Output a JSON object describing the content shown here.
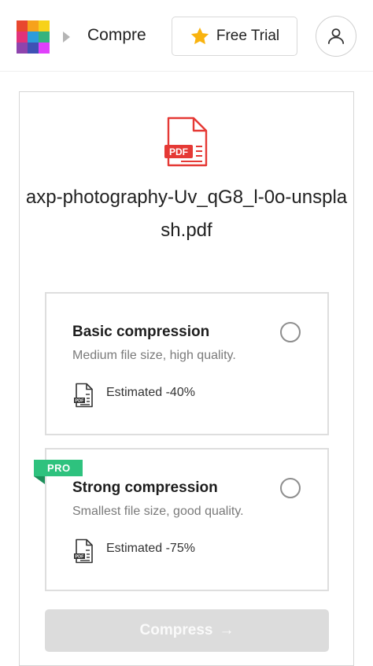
{
  "header": {
    "breadcrumb_label": "Compre",
    "free_trial_label": "Free Trial",
    "logo_colors": [
      "#e8472f",
      "#f6a21b",
      "#f7d21a",
      "#e2327a",
      "#2d9cdb",
      "#36b37e",
      "#8e44ad",
      "#3f51b5",
      "#e040fb"
    ],
    "star_color": "#f9b30f"
  },
  "file": {
    "badge": "PDF",
    "name": "axp-photography-Uv_qG8_l-0o-unsplash.pdf",
    "icon_color": "#e53935"
  },
  "options": [
    {
      "title": "Basic compression",
      "description": "Medium file size, high quality.",
      "estimate": "Estimated -40%",
      "selected": false
    },
    {
      "badge": "PRO",
      "title": "Strong compression",
      "description": "Smallest file size, good quality.",
      "estimate": "Estimated -75%",
      "selected": false
    }
  ],
  "action": {
    "compress_label": "Compress",
    "arrow": "→",
    "enabled": false
  }
}
